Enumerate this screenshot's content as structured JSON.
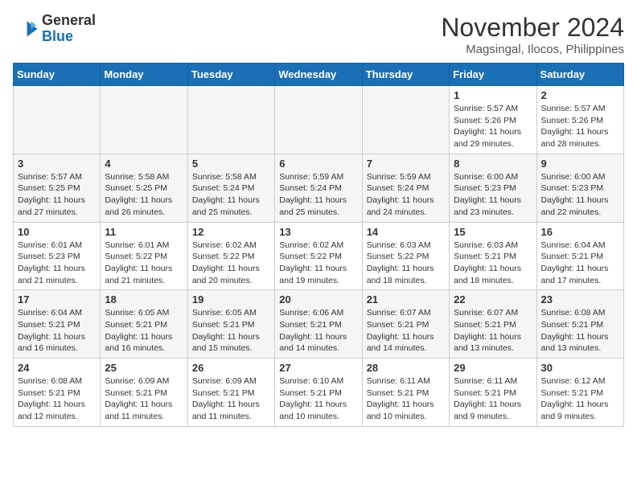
{
  "header": {
    "logo_line1": "General",
    "logo_line2": "Blue",
    "month_title": "November 2024",
    "location": "Magsingal, Ilocos, Philippines"
  },
  "weekdays": [
    "Sunday",
    "Monday",
    "Tuesday",
    "Wednesday",
    "Thursday",
    "Friday",
    "Saturday"
  ],
  "weeks": [
    {
      "alt": false,
      "days": [
        {
          "num": "",
          "info": ""
        },
        {
          "num": "",
          "info": ""
        },
        {
          "num": "",
          "info": ""
        },
        {
          "num": "",
          "info": ""
        },
        {
          "num": "",
          "info": ""
        },
        {
          "num": "1",
          "info": "Sunrise: 5:57 AM\nSunset: 5:26 PM\nDaylight: 11 hours\nand 29 minutes."
        },
        {
          "num": "2",
          "info": "Sunrise: 5:57 AM\nSunset: 5:26 PM\nDaylight: 11 hours\nand 28 minutes."
        }
      ]
    },
    {
      "alt": true,
      "days": [
        {
          "num": "3",
          "info": "Sunrise: 5:57 AM\nSunset: 5:25 PM\nDaylight: 11 hours\nand 27 minutes."
        },
        {
          "num": "4",
          "info": "Sunrise: 5:58 AM\nSunset: 5:25 PM\nDaylight: 11 hours\nand 26 minutes."
        },
        {
          "num": "5",
          "info": "Sunrise: 5:58 AM\nSunset: 5:24 PM\nDaylight: 11 hours\nand 25 minutes."
        },
        {
          "num": "6",
          "info": "Sunrise: 5:59 AM\nSunset: 5:24 PM\nDaylight: 11 hours\nand 25 minutes."
        },
        {
          "num": "7",
          "info": "Sunrise: 5:59 AM\nSunset: 5:24 PM\nDaylight: 11 hours\nand 24 minutes."
        },
        {
          "num": "8",
          "info": "Sunrise: 6:00 AM\nSunset: 5:23 PM\nDaylight: 11 hours\nand 23 minutes."
        },
        {
          "num": "9",
          "info": "Sunrise: 6:00 AM\nSunset: 5:23 PM\nDaylight: 11 hours\nand 22 minutes."
        }
      ]
    },
    {
      "alt": false,
      "days": [
        {
          "num": "10",
          "info": "Sunrise: 6:01 AM\nSunset: 5:23 PM\nDaylight: 11 hours\nand 21 minutes."
        },
        {
          "num": "11",
          "info": "Sunrise: 6:01 AM\nSunset: 5:22 PM\nDaylight: 11 hours\nand 21 minutes."
        },
        {
          "num": "12",
          "info": "Sunrise: 6:02 AM\nSunset: 5:22 PM\nDaylight: 11 hours\nand 20 minutes."
        },
        {
          "num": "13",
          "info": "Sunrise: 6:02 AM\nSunset: 5:22 PM\nDaylight: 11 hours\nand 19 minutes."
        },
        {
          "num": "14",
          "info": "Sunrise: 6:03 AM\nSunset: 5:22 PM\nDaylight: 11 hours\nand 18 minutes."
        },
        {
          "num": "15",
          "info": "Sunrise: 6:03 AM\nSunset: 5:21 PM\nDaylight: 11 hours\nand 18 minutes."
        },
        {
          "num": "16",
          "info": "Sunrise: 6:04 AM\nSunset: 5:21 PM\nDaylight: 11 hours\nand 17 minutes."
        }
      ]
    },
    {
      "alt": true,
      "days": [
        {
          "num": "17",
          "info": "Sunrise: 6:04 AM\nSunset: 5:21 PM\nDaylight: 11 hours\nand 16 minutes."
        },
        {
          "num": "18",
          "info": "Sunrise: 6:05 AM\nSunset: 5:21 PM\nDaylight: 11 hours\nand 16 minutes."
        },
        {
          "num": "19",
          "info": "Sunrise: 6:05 AM\nSunset: 5:21 PM\nDaylight: 11 hours\nand 15 minutes."
        },
        {
          "num": "20",
          "info": "Sunrise: 6:06 AM\nSunset: 5:21 PM\nDaylight: 11 hours\nand 14 minutes."
        },
        {
          "num": "21",
          "info": "Sunrise: 6:07 AM\nSunset: 5:21 PM\nDaylight: 11 hours\nand 14 minutes."
        },
        {
          "num": "22",
          "info": "Sunrise: 6:07 AM\nSunset: 5:21 PM\nDaylight: 11 hours\nand 13 minutes."
        },
        {
          "num": "23",
          "info": "Sunrise: 6:08 AM\nSunset: 5:21 PM\nDaylight: 11 hours\nand 13 minutes."
        }
      ]
    },
    {
      "alt": false,
      "days": [
        {
          "num": "24",
          "info": "Sunrise: 6:08 AM\nSunset: 5:21 PM\nDaylight: 11 hours\nand 12 minutes."
        },
        {
          "num": "25",
          "info": "Sunrise: 6:09 AM\nSunset: 5:21 PM\nDaylight: 11 hours\nand 11 minutes."
        },
        {
          "num": "26",
          "info": "Sunrise: 6:09 AM\nSunset: 5:21 PM\nDaylight: 11 hours\nand 11 minutes."
        },
        {
          "num": "27",
          "info": "Sunrise: 6:10 AM\nSunset: 5:21 PM\nDaylight: 11 hours\nand 10 minutes."
        },
        {
          "num": "28",
          "info": "Sunrise: 6:11 AM\nSunset: 5:21 PM\nDaylight: 11 hours\nand 10 minutes."
        },
        {
          "num": "29",
          "info": "Sunrise: 6:11 AM\nSunset: 5:21 PM\nDaylight: 11 hours\nand 9 minutes."
        },
        {
          "num": "30",
          "info": "Sunrise: 6:12 AM\nSunset: 5:21 PM\nDaylight: 11 hours\nand 9 minutes."
        }
      ]
    }
  ]
}
